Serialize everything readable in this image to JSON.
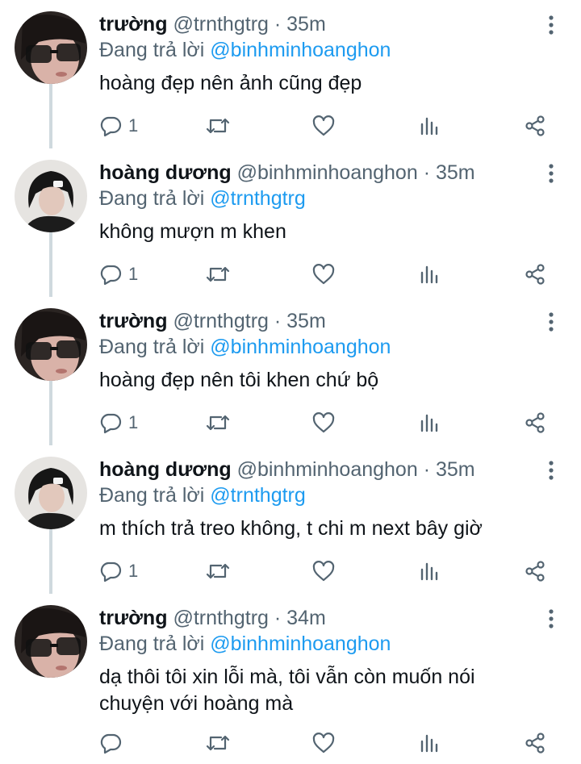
{
  "replying_label": "Đang trả lời",
  "tweets": [
    {
      "name": "trường",
      "handle": "@trnthgtrg",
      "separator": "·",
      "time": "35m",
      "reply_to": "@binhminhoanghon",
      "text": "hoàng đẹp nên ảnh cũng đẹp",
      "reply_count": "1"
    },
    {
      "name": "hoàng dương",
      "handle": "@binhminhoanghon",
      "separator": "·",
      "time": "35m",
      "reply_to": "@trnthgtrg",
      "text": "không mượn m khen",
      "reply_count": "1"
    },
    {
      "name": "trường",
      "handle": "@trnthgtrg",
      "separator": "·",
      "time": "35m",
      "reply_to": "@binhminhoanghon",
      "text": "hoàng đẹp nên tôi khen chứ bộ",
      "reply_count": "1"
    },
    {
      "name": "hoàng dương",
      "handle": "@binhminhoanghon",
      "separator": "·",
      "time": "35m",
      "reply_to": "@trnthgtrg",
      "text": "m thích trả treo không, t chi m next bây giờ",
      "reply_count": "1"
    },
    {
      "name": "trường",
      "handle": "@trnthgtrg",
      "separator": "·",
      "time": "34m",
      "reply_to": "@binhminhoanghon",
      "text": "dạ thôi tôi xin lỗi mà, tôi vẫn còn muốn nói chuyện với hoàng mà",
      "reply_count": ""
    }
  ],
  "icons": {
    "reply": "reply-bubble-icon",
    "retweet": "retweet-icon",
    "like": "heart-icon",
    "views": "analytics-bars-icon",
    "share": "share-icon",
    "more": "more-vertical-dots-icon"
  },
  "colors": {
    "name": "#0f1419",
    "secondary": "#536471",
    "mention": "#1d9bf0",
    "thread_line": "#cfd9de"
  }
}
